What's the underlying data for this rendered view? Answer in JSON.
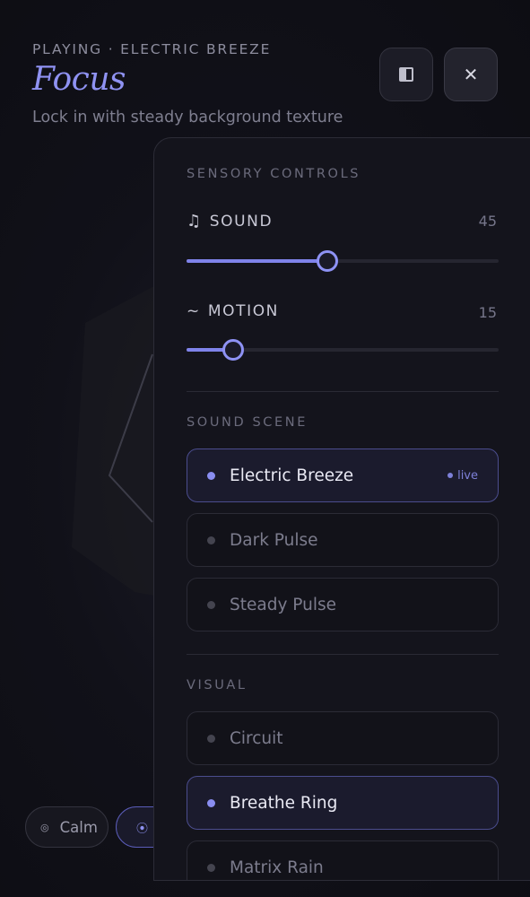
{
  "header": {
    "now_playing": "PLAYING · ELECTRIC BREEZE",
    "mode_title": "Focus",
    "mode_subtitle": "Lock in with steady background texture"
  },
  "toolbar": {
    "sidebar_icon": "sidebar-toggle-icon",
    "close_icon": "close-icon",
    "close_glyph": "✕",
    "sidebar_glyph": "◧"
  },
  "mode_chips": [
    {
      "label": "Calm",
      "icon": "calm-icon",
      "glyph": "◎"
    },
    {
      "label": "",
      "icon": "focus-icon",
      "glyph": "⦿",
      "active": true
    }
  ],
  "panel": {
    "sensory_title": "SENSORY CONTROLS",
    "sound": {
      "label": "SOUND",
      "icon": "music-note-icon",
      "glyph": "♫",
      "value": "45",
      "level": 45
    },
    "motion": {
      "label": "MOTION",
      "icon": "wave-icon",
      "glyph": "~",
      "value": "15",
      "level": 15
    },
    "scene_title": "SOUND SCENE",
    "scenes": [
      {
        "label": "Electric Breeze",
        "active": true,
        "badge": "live"
      },
      {
        "label": "Dark Pulse",
        "active": false
      },
      {
        "label": "Steady Pulse",
        "active": false
      }
    ],
    "visual_title": "VISUAL",
    "visuals": [
      {
        "label": "Circuit",
        "active": false
      },
      {
        "label": "Breathe Ring",
        "active": true
      },
      {
        "label": "Matrix Rain",
        "active": false
      }
    ]
  },
  "colors": {
    "accent": "#8f92f2",
    "background": "#0e0e15",
    "panel": "#14141c"
  }
}
